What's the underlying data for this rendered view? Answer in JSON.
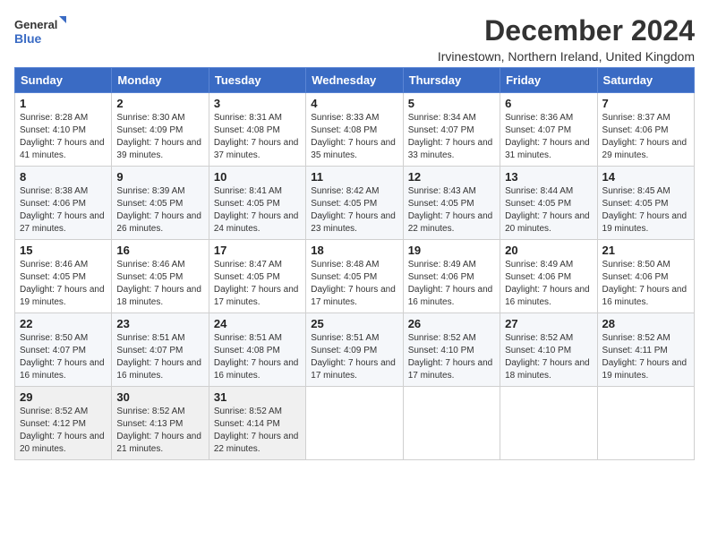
{
  "logo": {
    "line1": "General",
    "line2": "Blue"
  },
  "title": "December 2024",
  "subtitle": "Irvinestown, Northern Ireland, United Kingdom",
  "weekdays": [
    "Sunday",
    "Monday",
    "Tuesday",
    "Wednesday",
    "Thursday",
    "Friday",
    "Saturday"
  ],
  "weeks": [
    [
      {
        "day": "1",
        "sunrise": "8:28 AM",
        "sunset": "4:10 PM",
        "daylight": "7 hours and 41 minutes."
      },
      {
        "day": "2",
        "sunrise": "8:30 AM",
        "sunset": "4:09 PM",
        "daylight": "7 hours and 39 minutes."
      },
      {
        "day": "3",
        "sunrise": "8:31 AM",
        "sunset": "4:08 PM",
        "daylight": "7 hours and 37 minutes."
      },
      {
        "day": "4",
        "sunrise": "8:33 AM",
        "sunset": "4:08 PM",
        "daylight": "7 hours and 35 minutes."
      },
      {
        "day": "5",
        "sunrise": "8:34 AM",
        "sunset": "4:07 PM",
        "daylight": "7 hours and 33 minutes."
      },
      {
        "day": "6",
        "sunrise": "8:36 AM",
        "sunset": "4:07 PM",
        "daylight": "7 hours and 31 minutes."
      },
      {
        "day": "7",
        "sunrise": "8:37 AM",
        "sunset": "4:06 PM",
        "daylight": "7 hours and 29 minutes."
      }
    ],
    [
      {
        "day": "8",
        "sunrise": "8:38 AM",
        "sunset": "4:06 PM",
        "daylight": "7 hours and 27 minutes."
      },
      {
        "day": "9",
        "sunrise": "8:39 AM",
        "sunset": "4:05 PM",
        "daylight": "7 hours and 26 minutes."
      },
      {
        "day": "10",
        "sunrise": "8:41 AM",
        "sunset": "4:05 PM",
        "daylight": "7 hours and 24 minutes."
      },
      {
        "day": "11",
        "sunrise": "8:42 AM",
        "sunset": "4:05 PM",
        "daylight": "7 hours and 23 minutes."
      },
      {
        "day": "12",
        "sunrise": "8:43 AM",
        "sunset": "4:05 PM",
        "daylight": "7 hours and 22 minutes."
      },
      {
        "day": "13",
        "sunrise": "8:44 AM",
        "sunset": "4:05 PM",
        "daylight": "7 hours and 20 minutes."
      },
      {
        "day": "14",
        "sunrise": "8:45 AM",
        "sunset": "4:05 PM",
        "daylight": "7 hours and 19 minutes."
      }
    ],
    [
      {
        "day": "15",
        "sunrise": "8:46 AM",
        "sunset": "4:05 PM",
        "daylight": "7 hours and 19 minutes."
      },
      {
        "day": "16",
        "sunrise": "8:46 AM",
        "sunset": "4:05 PM",
        "daylight": "7 hours and 18 minutes."
      },
      {
        "day": "17",
        "sunrise": "8:47 AM",
        "sunset": "4:05 PM",
        "daylight": "7 hours and 17 minutes."
      },
      {
        "day": "18",
        "sunrise": "8:48 AM",
        "sunset": "4:05 PM",
        "daylight": "7 hours and 17 minutes."
      },
      {
        "day": "19",
        "sunrise": "8:49 AM",
        "sunset": "4:06 PM",
        "daylight": "7 hours and 16 minutes."
      },
      {
        "day": "20",
        "sunrise": "8:49 AM",
        "sunset": "4:06 PM",
        "daylight": "7 hours and 16 minutes."
      },
      {
        "day": "21",
        "sunrise": "8:50 AM",
        "sunset": "4:06 PM",
        "daylight": "7 hours and 16 minutes."
      }
    ],
    [
      {
        "day": "22",
        "sunrise": "8:50 AM",
        "sunset": "4:07 PM",
        "daylight": "7 hours and 16 minutes."
      },
      {
        "day": "23",
        "sunrise": "8:51 AM",
        "sunset": "4:07 PM",
        "daylight": "7 hours and 16 minutes."
      },
      {
        "day": "24",
        "sunrise": "8:51 AM",
        "sunset": "4:08 PM",
        "daylight": "7 hours and 16 minutes."
      },
      {
        "day": "25",
        "sunrise": "8:51 AM",
        "sunset": "4:09 PM",
        "daylight": "7 hours and 17 minutes."
      },
      {
        "day": "26",
        "sunrise": "8:52 AM",
        "sunset": "4:10 PM",
        "daylight": "7 hours and 17 minutes."
      },
      {
        "day": "27",
        "sunrise": "8:52 AM",
        "sunset": "4:10 PM",
        "daylight": "7 hours and 18 minutes."
      },
      {
        "day": "28",
        "sunrise": "8:52 AM",
        "sunset": "4:11 PM",
        "daylight": "7 hours and 19 minutes."
      }
    ],
    [
      {
        "day": "29",
        "sunrise": "8:52 AM",
        "sunset": "4:12 PM",
        "daylight": "7 hours and 20 minutes."
      },
      {
        "day": "30",
        "sunrise": "8:52 AM",
        "sunset": "4:13 PM",
        "daylight": "7 hours and 21 minutes."
      },
      {
        "day": "31",
        "sunrise": "8:52 AM",
        "sunset": "4:14 PM",
        "daylight": "7 hours and 22 minutes."
      },
      null,
      null,
      null,
      null
    ]
  ]
}
